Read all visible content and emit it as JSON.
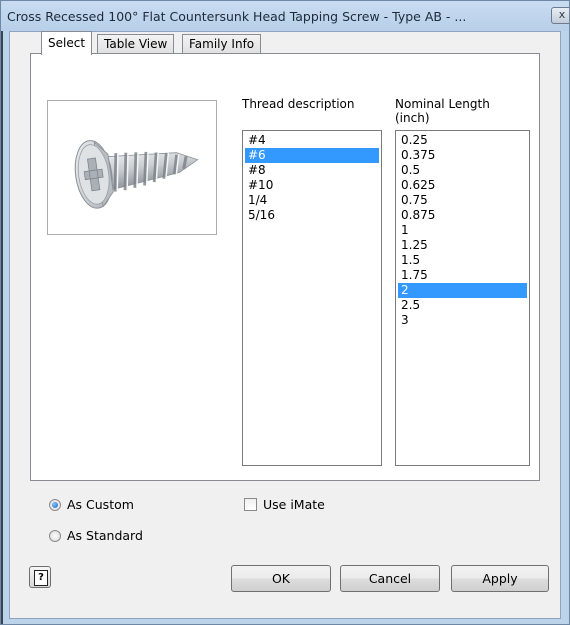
{
  "window": {
    "title": "Cross Recessed 100° Flat Countersunk Head Tapping Screw - Type AB - ...",
    "close_glyph": "x"
  },
  "tabs": [
    {
      "label": "Select",
      "active": true
    },
    {
      "label": "Table View",
      "active": false
    },
    {
      "label": "Family Info",
      "active": false
    }
  ],
  "thread": {
    "header": "Thread description",
    "items": [
      "#4",
      "#6",
      "#8",
      "#10",
      "1/4",
      "5/16"
    ],
    "selected": "#6"
  },
  "length": {
    "header_line1": "Nominal Length",
    "header_line2": "(inch)",
    "items": [
      "0.25",
      "0.375",
      "0.5",
      "0.625",
      "0.75",
      "0.875",
      "1",
      "1.25",
      "1.5",
      "1.75",
      "2",
      "2.5",
      "3"
    ],
    "selected": "2"
  },
  "options": {
    "as_custom": "As Custom",
    "as_standard": "As Standard",
    "use_imate": "Use iMate",
    "selected_mode": "As Custom",
    "use_imate_checked": false
  },
  "buttons": {
    "help": "?",
    "ok": "OK",
    "cancel": "Cancel",
    "apply": "Apply"
  },
  "icons": {
    "preview": "screw-image",
    "help": "help-icon",
    "close": "close-icon"
  },
  "colors": {
    "selection": "#3399ff",
    "title_bar": "#bdd3ea"
  }
}
